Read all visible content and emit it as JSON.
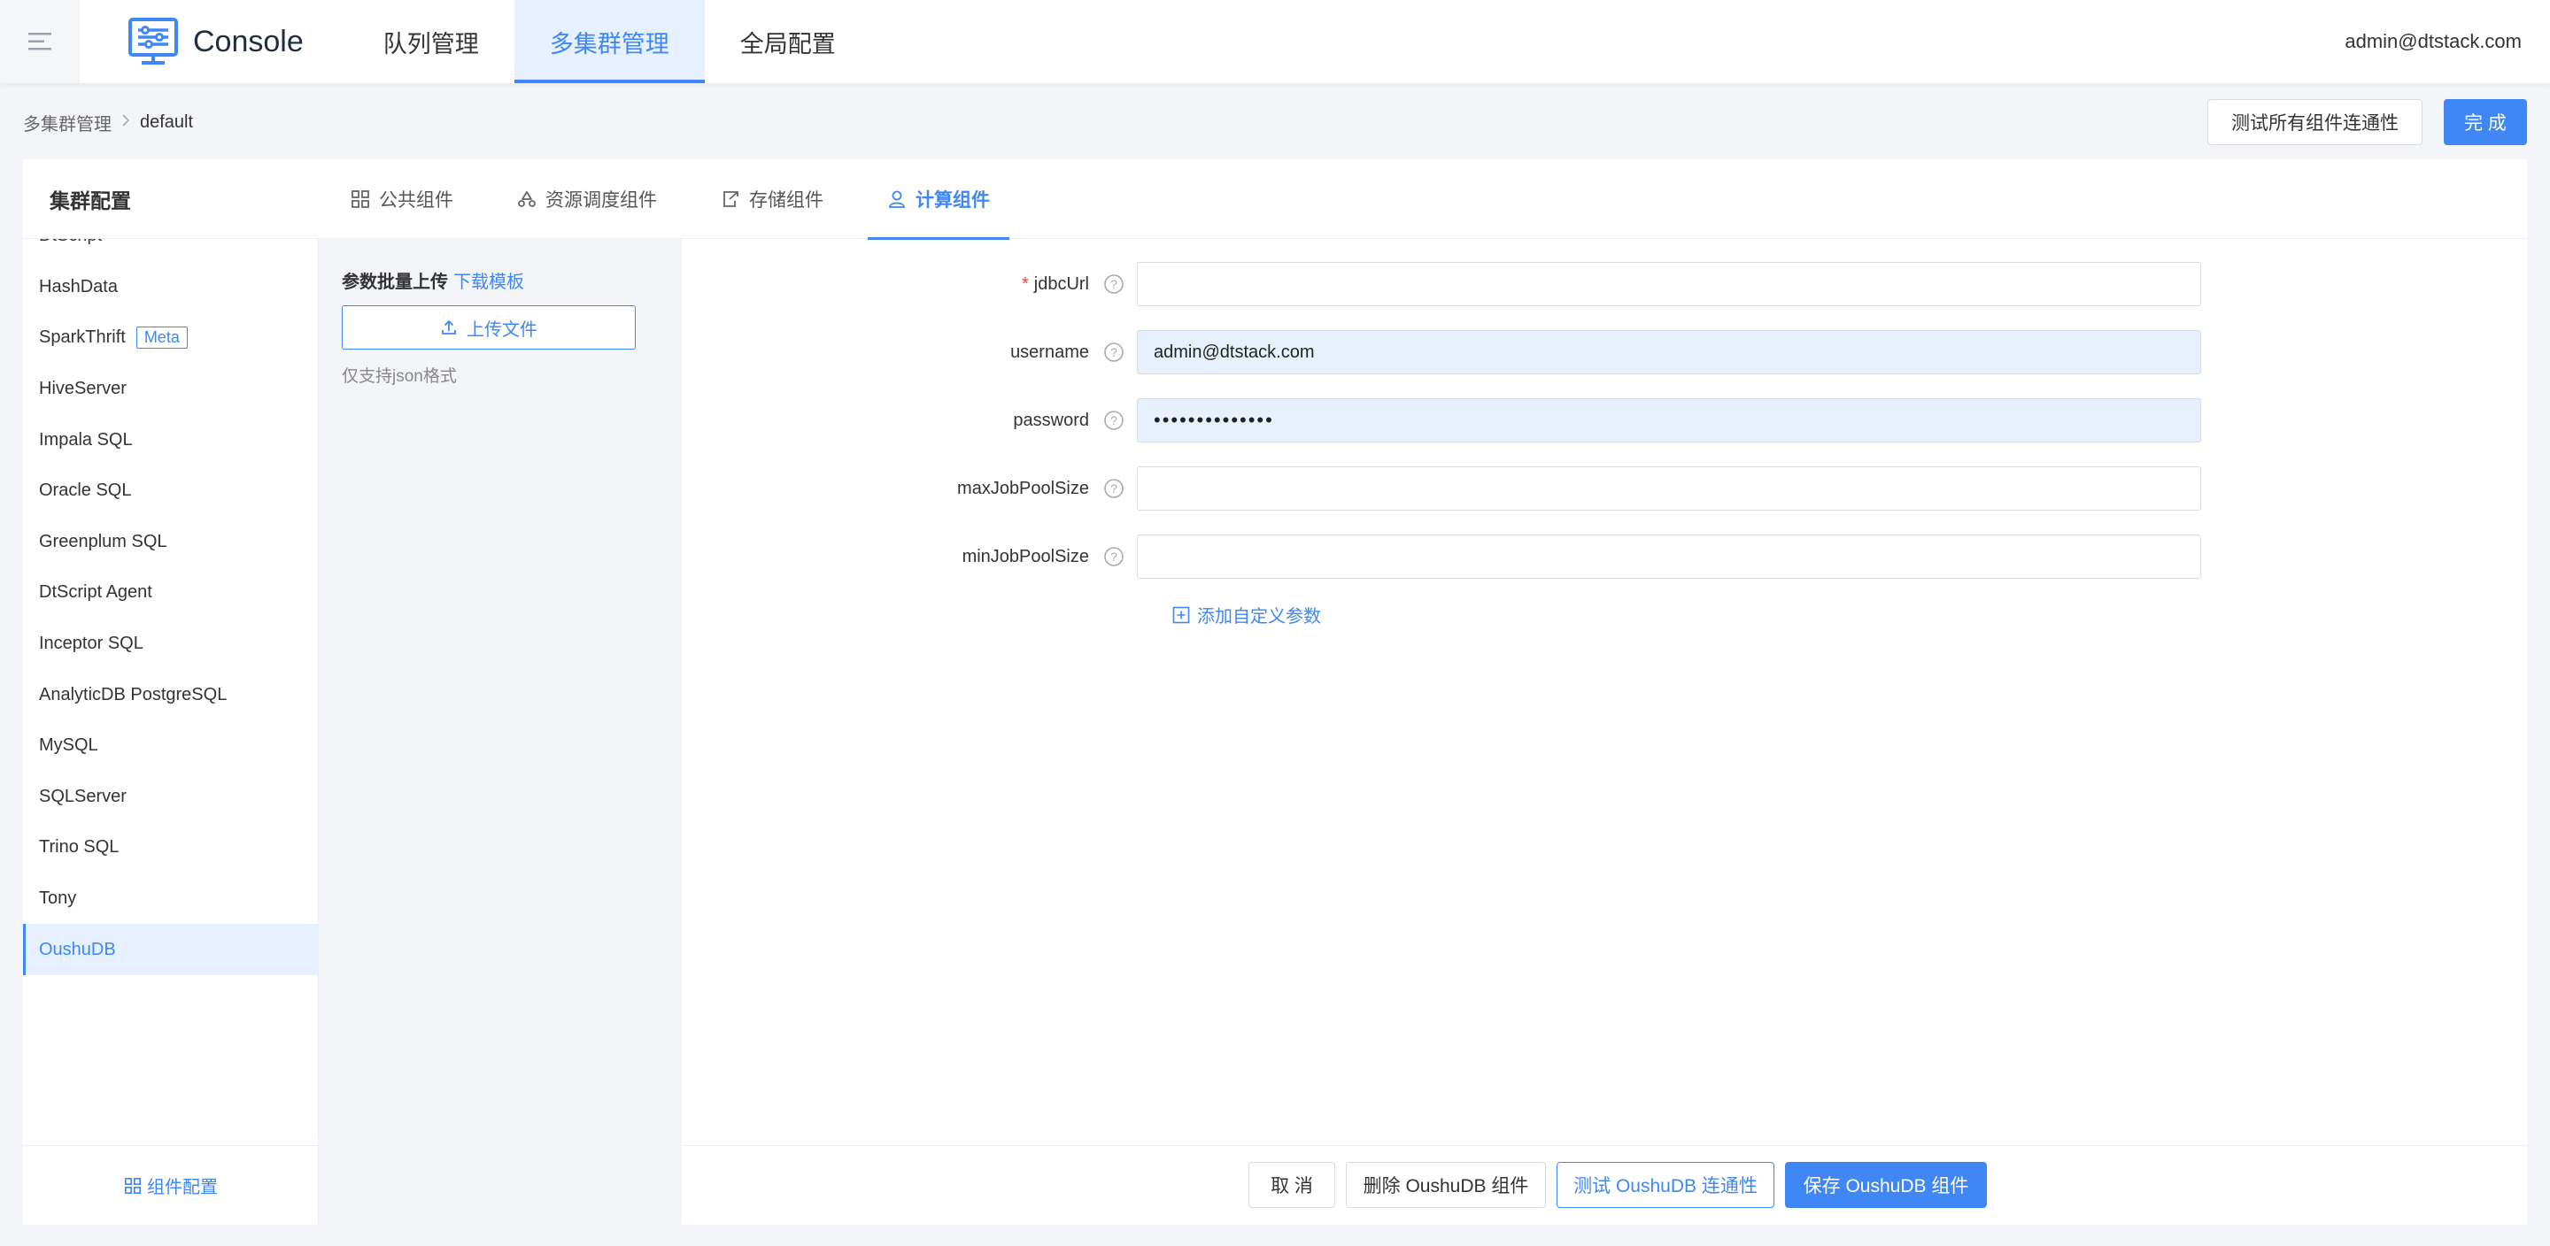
{
  "header": {
    "brand": "Console",
    "nav": [
      {
        "label": "队列管理",
        "active": false
      },
      {
        "label": "多集群管理",
        "active": true
      },
      {
        "label": "全局配置",
        "active": false
      }
    ],
    "user": "admin@dtstack.com",
    "accent_color": "#3f87f5"
  },
  "breadcrumb": {
    "root": "多集群管理",
    "current": "default"
  },
  "actions": {
    "test_all": "测试所有组件连通性",
    "finish": "完 成"
  },
  "panel": {
    "title": "集群配置",
    "tabs": [
      {
        "label": "公共组件",
        "icon": "grid-icon",
        "active": false
      },
      {
        "label": "资源调度组件",
        "icon": "recycle-icon",
        "active": false
      },
      {
        "label": "存储组件",
        "icon": "export-icon",
        "active": false
      },
      {
        "label": "计算组件",
        "icon": "user-icon",
        "active": true
      }
    ]
  },
  "components": {
    "items": [
      {
        "label": "DtScript"
      },
      {
        "label": "HashData"
      },
      {
        "label": "SparkThrift",
        "tag": "Meta"
      },
      {
        "label": "HiveServer"
      },
      {
        "label": "Impala SQL"
      },
      {
        "label": "Oracle SQL"
      },
      {
        "label": "Greenplum SQL"
      },
      {
        "label": "DtScript Agent"
      },
      {
        "label": "Inceptor SQL"
      },
      {
        "label": "AnalyticDB PostgreSQL"
      },
      {
        "label": "MySQL"
      },
      {
        "label": "SQLServer"
      },
      {
        "label": "Trino SQL"
      },
      {
        "label": "Tony"
      },
      {
        "label": "OushuDB",
        "active": true
      }
    ],
    "more": "...",
    "config_label": "组件配置"
  },
  "upload": {
    "title": "参数批量上传",
    "download_link": "下载模板",
    "button": "上传文件",
    "hint": "仅支持json格式"
  },
  "form": {
    "fields": [
      {
        "label": "jdbcUrl",
        "required": true,
        "value": ""
      },
      {
        "label": "username",
        "required": false,
        "value": "admin@dtstack.com"
      },
      {
        "label": "password",
        "required": false,
        "value": "••••••••••••••"
      },
      {
        "label": "maxJobPoolSize",
        "required": false,
        "value": ""
      },
      {
        "label": "minJobPoolSize",
        "required": false,
        "value": ""
      }
    ],
    "add_param": "添加自定义参数"
  },
  "footer": {
    "cancel": "取 消",
    "delete": "删除 OushuDB 组件",
    "test": "测试 OushuDB 连通性",
    "save": "保存 OushuDB 组件"
  }
}
